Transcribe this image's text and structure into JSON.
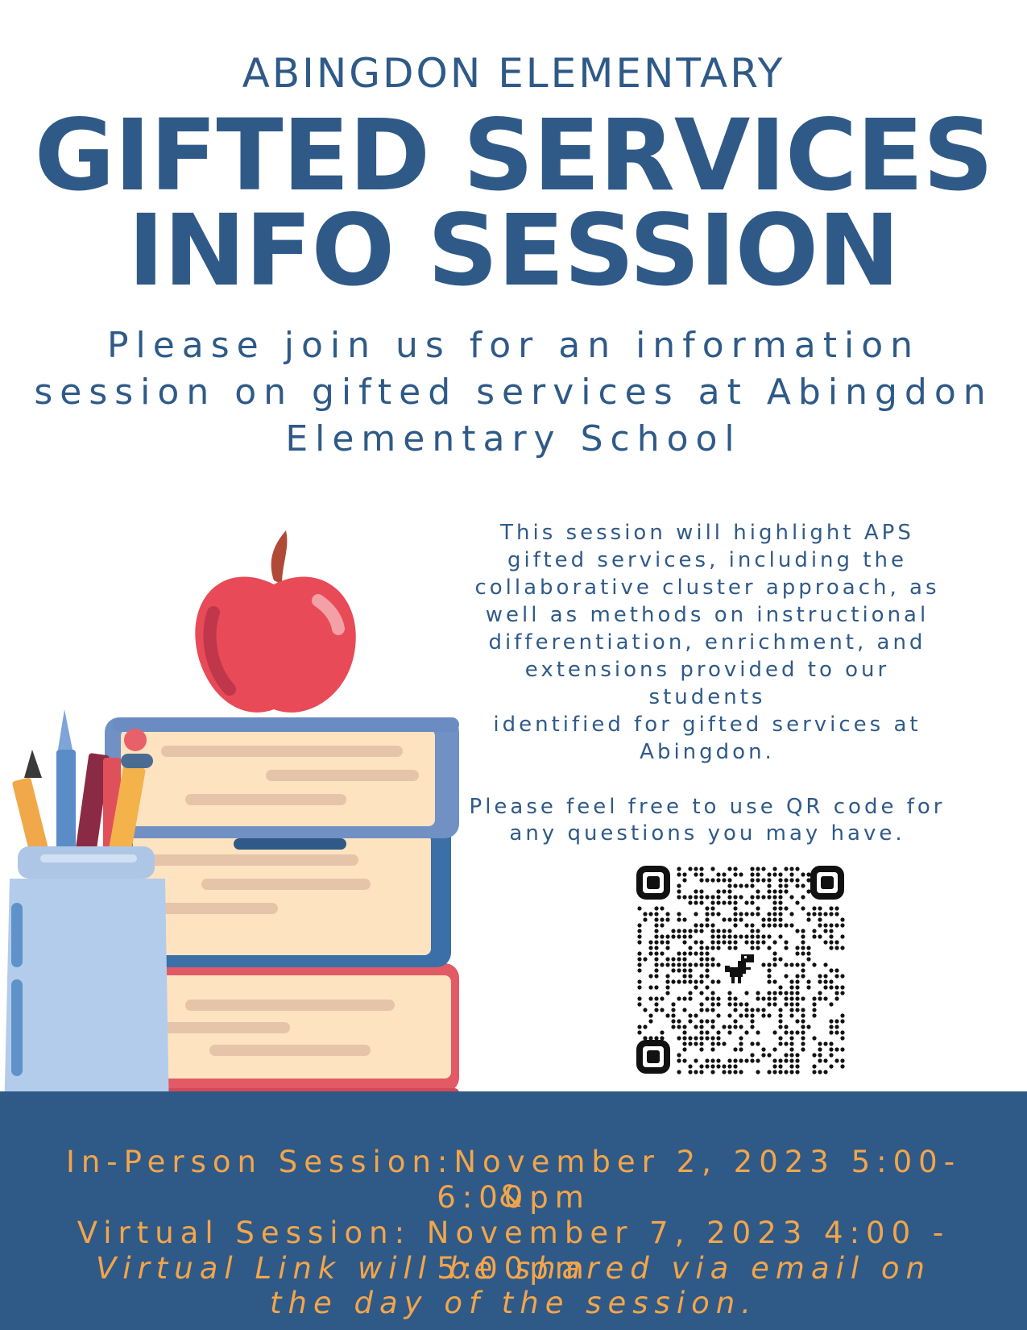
{
  "header": {
    "school": "ABINGDON ELEMENTARY",
    "title_line1": "GIFTED SERVICES",
    "title_line2": "INFO SESSION",
    "invite_line1": "Please join us for an information",
    "invite_line2": "session on gifted services at Abingdon",
    "invite_line3": "Elementary School"
  },
  "body": {
    "lines": [
      "This session will highlight APS",
      "gifted services, including the",
      "collaborative cluster approach, as",
      "well as methods on instructional",
      "differentiation, enrichment, and",
      "extensions provided to our",
      "students",
      "identified for gifted services at",
      "Abingdon."
    ],
    "qr_note_line1": "Please feel free to use QR code for",
    "qr_note_line2": "any questions you may have."
  },
  "footer": {
    "in_person": "In-Person Session:November 2, 2023 5:00-6:00pm",
    "ampersand": "&",
    "virtual": "Virtual Session: November 7, 2023 4:00 - 5:00pm",
    "link_note_line1": "Virtual Link will be shared via email on",
    "link_note_line2": "the day of the session."
  },
  "colors": {
    "primary": "#2f5a88",
    "accent": "#f3a54a",
    "background": "#ffffff"
  },
  "icons": {
    "illustration": "apple-books-pencil-cup-illustration",
    "qr": "qr-code-icon",
    "qr_center": "dinosaur-icon"
  }
}
